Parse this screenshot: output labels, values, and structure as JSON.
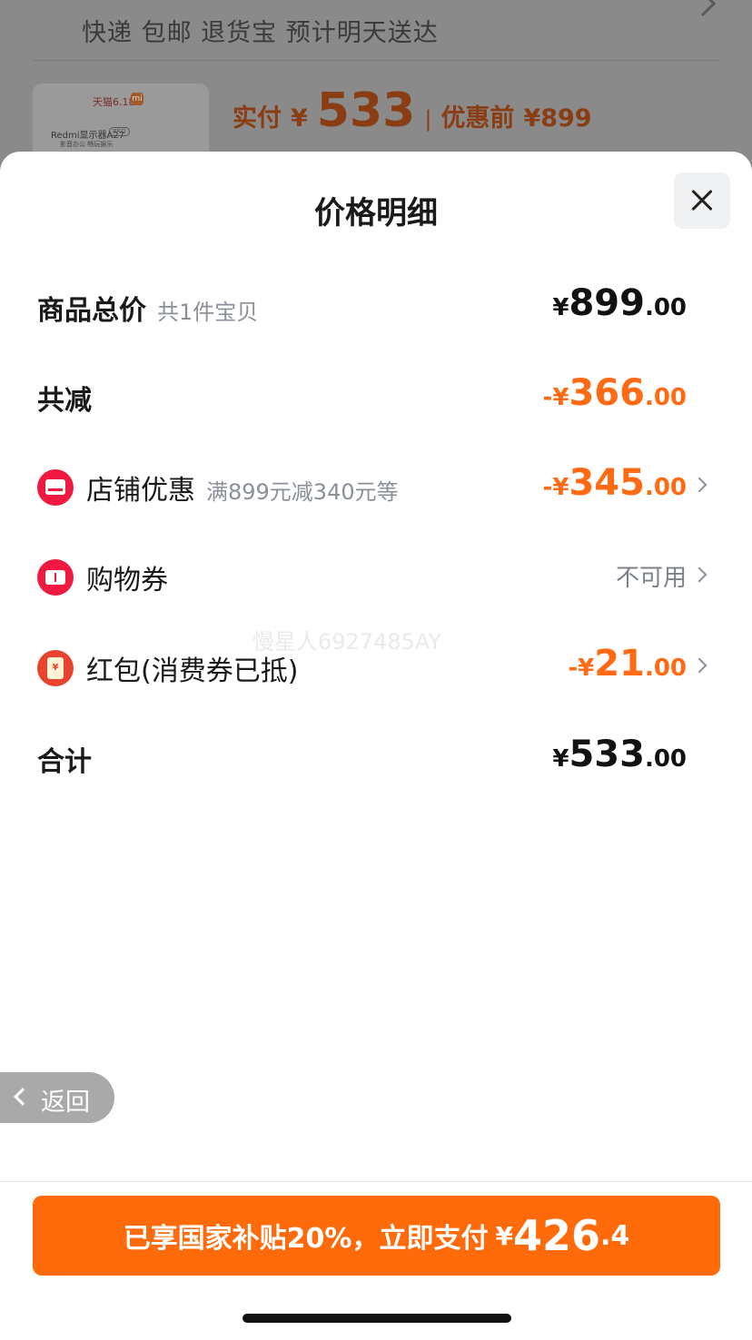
{
  "background": {
    "shipping_text": "快递 包邮 退货宝 预计明天送达",
    "product": {
      "store_logo_text": "天猫6.18",
      "mi_badge": "mi",
      "title": "Redmi显示器A27",
      "tag": "PRO",
      "subtitle": "影音办公 畅玩娱乐"
    },
    "actual_pay_label": "实付",
    "actual_pay_currency": "¥",
    "actual_pay_amount": "533",
    "separator": "|",
    "before_discount_label": "优惠前",
    "before_discount_amount": "¥899"
  },
  "sheet": {
    "title": "价格明细",
    "close_icon": "close-icon"
  },
  "rows": {
    "total": {
      "label": "商品总价",
      "sub": "共1件宝贝",
      "currency": "¥",
      "int": "899",
      "dec": ".00"
    },
    "reduce": {
      "label": "共减",
      "currency": "-¥",
      "int": "366",
      "dec": ".00"
    },
    "store_discount": {
      "icon": "store-icon",
      "label": "店铺优惠",
      "sub": "满899元减340元等",
      "currency": "-¥",
      "int": "345",
      "dec": ".00"
    },
    "coupon": {
      "icon": "ticket-icon",
      "label": "购物券",
      "status": "不可用"
    },
    "red_packet": {
      "icon": "red-packet-icon",
      "icon_glyph": "¥",
      "label": "红包(消费券已抵)",
      "currency": "-¥",
      "int": "21",
      "dec": ".00"
    },
    "sum": {
      "label": "合计",
      "currency": "¥",
      "int": "533",
      "dec": ".00"
    }
  },
  "watermark": "慢星人6927485AY",
  "back_button": {
    "label": "返回"
  },
  "pay_button": {
    "text": "已享国家补贴20%，立即支付",
    "currency": "¥",
    "int": "426",
    "dec": ".4"
  },
  "colors": {
    "accent_orange": "#ff6a13",
    "pay_button": "#ff6a0a",
    "icon_red": "#f0193f"
  }
}
